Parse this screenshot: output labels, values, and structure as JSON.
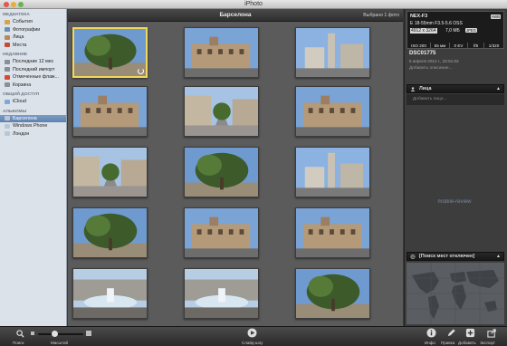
{
  "window": {
    "title": "iPhoto"
  },
  "sidebar": {
    "sections": [
      {
        "header": "МЕДИАТЕКА",
        "items": [
          {
            "label": "События",
            "icon": "events-icon",
            "color": "#d8a24a"
          },
          {
            "label": "Фотографии",
            "icon": "photos-icon",
            "color": "#6c8fb6"
          },
          {
            "label": "Лица",
            "icon": "faces-icon",
            "color": "#b48a5a"
          },
          {
            "label": "Места",
            "icon": "places-icon",
            "color": "#c44b3a"
          }
        ]
      },
      {
        "header": "НЕДАВНИЕ",
        "items": [
          {
            "label": "Последние 12 мес",
            "icon": "calendar-icon",
            "color": "#8a8f96"
          },
          {
            "label": "Последний импорт",
            "icon": "import-icon",
            "color": "#8a8f96"
          },
          {
            "label": "Отмеченные флаж...",
            "icon": "flag-icon",
            "color": "#d64a32"
          },
          {
            "label": "Корзина",
            "icon": "trash-icon",
            "color": "#8a8f96"
          }
        ]
      },
      {
        "header": "ОБЩИЙ ДОСТУП",
        "items": [
          {
            "label": "iCloud",
            "icon": "cloud-icon",
            "color": "#7fa8d8"
          }
        ]
      },
      {
        "header": "АЛЬБОМЫ",
        "items": [
          {
            "label": "Барселона",
            "icon": "album-icon",
            "color": "#b9c6d6",
            "selected": true
          },
          {
            "label": "Windows Phone",
            "icon": "album-icon",
            "color": "#b9c6d6"
          },
          {
            "label": "Лондон",
            "icon": "album-icon",
            "color": "#b9c6d6"
          }
        ]
      }
    ]
  },
  "event": {
    "name": "Барселона",
    "selection": "Выбрано 1 фото"
  },
  "photos": [
    {
      "kind": "tree",
      "selected": true
    },
    {
      "kind": "building"
    },
    {
      "kind": "tower"
    },
    {
      "kind": "building"
    },
    {
      "kind": "street"
    },
    {
      "kind": "building"
    },
    {
      "kind": "street"
    },
    {
      "kind": "tree"
    },
    {
      "kind": "tower"
    },
    {
      "kind": "tree"
    },
    {
      "kind": "building"
    },
    {
      "kind": "building"
    },
    {
      "kind": "fountain"
    },
    {
      "kind": "fountain"
    },
    {
      "kind": "tree"
    }
  ],
  "info": {
    "camera": "NEX-F3",
    "mode": "AWB",
    "lens": "E 18-55mm F3.5-5.6 OSS",
    "dimensions": "4912 x 3264",
    "size": "7,0 МБ",
    "format": "JPEG",
    "exif_cells": [
      "ISO 200",
      "55 мм",
      "0 EV",
      "f/8",
      "1/320"
    ],
    "filename": "DSC01775",
    "date": "5 апреля 2012 г., 22:51:03",
    "description": "Добавить описание...",
    "faces_header": "Лица",
    "faces_placeholder": "Добавить лицо...",
    "map_header": "[Поиск мест отключен]"
  },
  "watermark": "mobile-review",
  "toolbar": {
    "search": "Поиск",
    "zoom": "Масштаб",
    "zoom_level": 0.35,
    "slideshow": "Слайд-шоу",
    "info": "Инфо",
    "edit": "Правка",
    "add": "Добавить",
    "export": "Экспорт"
  },
  "colors": {
    "accent": "#f1d85c",
    "selection": "#5e81b0"
  }
}
